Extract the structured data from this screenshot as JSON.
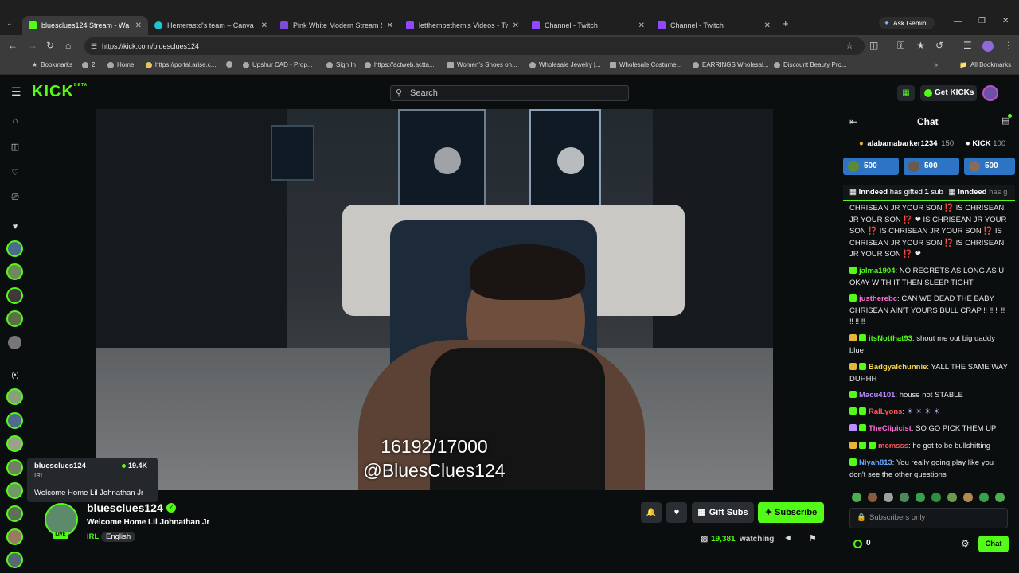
{
  "browser": {
    "tabs": [
      {
        "label": "bluesclues124 Stream - Wa",
        "active": true,
        "color": "#53fc18"
      },
      {
        "label": "Hemerastd's team – Canva",
        "active": false,
        "color": "#20c4cb"
      },
      {
        "label": "Pink White Modern Stream Sta",
        "active": false,
        "color": "#7d4cdb"
      },
      {
        "label": "letthembethem's Videos - Twitc",
        "active": false,
        "color": "#9146ff"
      },
      {
        "label": "Channel - Twitch",
        "active": false,
        "color": "#9146ff"
      },
      {
        "label": "Channel - Twitch",
        "active": false,
        "color": "#9146ff"
      }
    ],
    "ask_gemini": "Ask Gemini",
    "url": "https://kick.com/bluesclues124",
    "bookmarks": [
      {
        "label": "Bookmarks"
      },
      {
        "label": "2"
      },
      {
        "label": "Home"
      },
      {
        "label": "https://portal.arise.c..."
      },
      {
        "label": "Upshur CAD - Prop..."
      },
      {
        "label": "Sign In"
      },
      {
        "label": "https://actweb.actta..."
      },
      {
        "label": "Women's Shoes on..."
      },
      {
        "label": "Wholesale Jewelry |..."
      },
      {
        "label": "Wholesale Costume..."
      },
      {
        "label": "EARRINGS Wholesal..."
      },
      {
        "label": "Discount Beauty Pro..."
      }
    ],
    "all_bookmarks": "All Bookmarks"
  },
  "header": {
    "logo": "KICK",
    "logo_beta": "BETA",
    "search_placeholder": "Search",
    "get_kicks": "Get KICKs"
  },
  "video": {
    "overlay_count": "16192/17000",
    "overlay_handle": "@BluesClues124"
  },
  "hover_card": {
    "name": "bluesclues124",
    "category": "IRL",
    "viewers": "19.4K",
    "title": "Welcome Home Lil Johnathan Jr"
  },
  "stream": {
    "name": "bluesclues124",
    "title": "Welcome Home Lil Johnathan Jr",
    "tag_category": "IRL",
    "tag_language": "English",
    "live_label": "LIVE",
    "gift_subs": "Gift Subs",
    "subscribe": "Subscribe",
    "viewer_count": "19,381",
    "watching": "watching"
  },
  "chat": {
    "title": "Chat",
    "top_gifter": "alabamabarker1234",
    "top_gifter_count": "150",
    "kick_label": "KICK",
    "kick_count": "100",
    "sub_goals": [
      "500",
      "500",
      "500"
    ],
    "gifted_banner": {
      "user": "Inndeed",
      "text": "has gifted",
      "count": "1",
      "unit": "sub",
      "user2": "Inndeed",
      "text2": "has g"
    },
    "partial_message": "CHRISEAN JR YOUR SON ⁉️ IS CHRISEAN JR YOUR SON ⁉️ ❤ IS CHRISEAN JR YOUR SON ⁉️ IS CHRISEAN JR YOUR SON ⁉️ IS CHRISEAN JR YOUR SON ⁉️ IS CHRISEAN JR YOUR SON ⁉️ ❤",
    "messages": [
      {
        "user": "jalma1904",
        "color": "#53fc18",
        "text": "NO REGRETS AS LONG AS U OKAY WITH IT THEN SLEEP TIGHT"
      },
      {
        "user": "justherebc",
        "color": "#ff6ad5",
        "text": "CAN WE DEAD THE BABY CHRISEAN AIN'T YOURS BULL CRAP ‼ ‼ ‼ ‼ ‼ ‼ ‼"
      },
      {
        "user": "itsNotthat93",
        "color": "#53fc18",
        "text": "shout me out big daddy blue"
      },
      {
        "user": "Badgyalchunnie",
        "color": "#f7d44a",
        "text": "YALL THE SAME WAY DUHHH"
      },
      {
        "user": "Macu4101",
        "color": "#b98cff",
        "text": "house not STABLE"
      },
      {
        "user": "RalLyons",
        "color": "#ff5a5a",
        "text": "☀ ☀ ☀ ☀"
      },
      {
        "user": "TheClipicist",
        "color": "#ff6ad5",
        "text": "SO GO PICK THEM UP"
      },
      {
        "user": "mcmsss",
        "color": "#ff5a5a",
        "text": "he got to be bullshitting"
      },
      {
        "user": "Niyah813",
        "color": "#6aa8ff",
        "text": "You really going play like you don't see the other questions"
      }
    ],
    "input_placeholder": "Subscribers only",
    "kicks_count": "0",
    "send": "Chat"
  },
  "colors": {
    "brand": "#53fc18",
    "background": "#0b0e0f",
    "panel": "#24272c"
  }
}
